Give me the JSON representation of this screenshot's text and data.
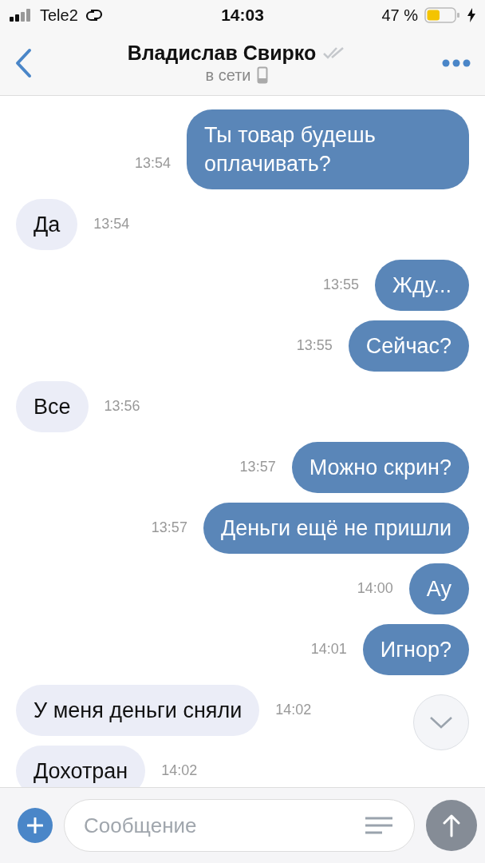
{
  "status_bar": {
    "carrier": "Tele2",
    "time": "14:03",
    "battery": "47 %",
    "charging": true
  },
  "header": {
    "name": "Владислав Свирко",
    "status": "в сети"
  },
  "messages": [
    {
      "kind": "outgoing",
      "text": "Ты товар будешь оплачивать?",
      "time": "13:54"
    },
    {
      "kind": "incoming",
      "text": "Да",
      "time": "13:54"
    },
    {
      "kind": "outgoing",
      "text": "Жду...",
      "time": "13:55"
    },
    {
      "kind": "outgoing",
      "text": "Сейчас?",
      "time": "13:55"
    },
    {
      "kind": "incoming",
      "text": "Все",
      "time": "13:56"
    },
    {
      "kind": "outgoing",
      "text": "Можно скрин?",
      "time": "13:57"
    },
    {
      "kind": "outgoing",
      "text": "Деньги ещё не пришли",
      "time": "13:57"
    },
    {
      "kind": "outgoing",
      "text": "Ау",
      "time": "14:00"
    },
    {
      "kind": "outgoing",
      "text": "Игнор?",
      "time": "14:01"
    },
    {
      "kind": "incoming",
      "text": "У меня деньги сняли",
      "time": "14:02"
    },
    {
      "kind": "incoming",
      "text": "Дохотран",
      "time": "14:02"
    }
  ],
  "composer": {
    "placeholder": "Сообщение"
  }
}
